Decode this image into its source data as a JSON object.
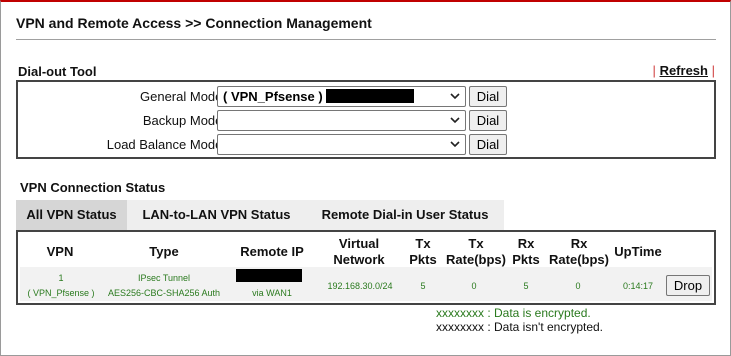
{
  "header": {
    "title": "VPN and Remote Access >> Connection Management"
  },
  "dial_out": {
    "section_label": "Dial-out Tool",
    "refresh_label": "Refresh",
    "rows": [
      {
        "label": "General Mode:",
        "value": "( VPN_Pfsense )",
        "button": "Dial",
        "redacted": true
      },
      {
        "label": "Backup Mode:",
        "value": "",
        "button": "Dial",
        "redacted": false
      },
      {
        "label": "Load Balance Mode:",
        "value": "",
        "button": "Dial",
        "redacted": false
      }
    ]
  },
  "vpn_status": {
    "section_label": "VPN Connection Status",
    "tabs": [
      {
        "label": "All VPN Status",
        "active": true
      },
      {
        "label": "LAN-to-LAN VPN Status",
        "active": false
      },
      {
        "label": "Remote Dial-in User Status",
        "active": false
      }
    ],
    "columns": {
      "vpn": "VPN",
      "type": "Type",
      "remote_ip": "Remote IP",
      "virtual_network_1": "Virtual",
      "virtual_network_2": "Network",
      "tx_pkts_1": "Tx",
      "tx_pkts_2": "Pkts",
      "tx_rate_1": "Tx",
      "tx_rate_2": "Rate(bps)",
      "rx_pkts_1": "Rx",
      "rx_pkts_2": "Pkts",
      "rx_rate_1": "Rx",
      "rx_rate_2": "Rate(bps)",
      "uptime": "UpTime"
    },
    "rows": [
      {
        "index": "1",
        "name": "( VPN_Pfsense )",
        "type_1": "IPsec Tunnel",
        "type_2": "AES256-CBC-SHA256 Auth",
        "remote_ip_via": "via WAN1",
        "virtual_network": "192.168.30.0/24",
        "tx_pkts": "5",
        "tx_rate": "0",
        "rx_pkts": "5",
        "rx_rate": "0",
        "uptime": "0:14:17",
        "action": "Drop"
      }
    ],
    "legend": {
      "encrypted_code": "xxxxxxxx",
      "encrypted_text": " : Data is encrypted.",
      "plain_code": "xxxxxxxx",
      "plain_text": " : Data isn't encrypted."
    }
  },
  "colors": {
    "accent_top_border": "#c00000",
    "encrypted_text": "#2a7a1e",
    "active_tab": "#d6d6d6",
    "inactive_tab": "#eeeeee"
  }
}
